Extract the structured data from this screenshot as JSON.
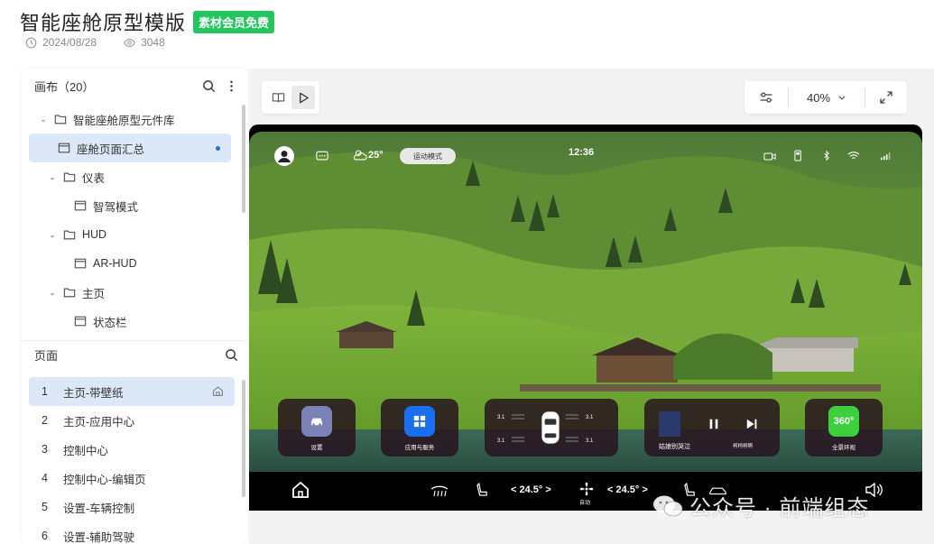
{
  "header": {
    "title": "智能座舱原型模版",
    "badge": "素材会员免费",
    "date": "2024/08/28",
    "views": "3048"
  },
  "canvas_panel": {
    "title": "画布（20）",
    "tree": [
      {
        "label": "智能座舱原型元件库",
        "type": "folder",
        "level": 1,
        "expanded": true
      },
      {
        "label": "座舱页面汇总",
        "type": "page",
        "level": 2,
        "selected": true
      },
      {
        "label": "仪表",
        "type": "folder",
        "level": 2,
        "expanded": true
      },
      {
        "label": "智驾模式",
        "type": "page",
        "level": 3
      },
      {
        "label": "HUD",
        "type": "folder",
        "level": 2,
        "expanded": true
      },
      {
        "label": "AR-HUD",
        "type": "page",
        "level": 3
      },
      {
        "label": "主页",
        "type": "folder",
        "level": 2,
        "expanded": true
      },
      {
        "label": "状态栏",
        "type": "page",
        "level": 3
      }
    ]
  },
  "pages_panel": {
    "title": "页面",
    "items": [
      {
        "num": "1",
        "label": "主页-带壁纸",
        "active": true
      },
      {
        "num": "2",
        "label": "主页-应用中心"
      },
      {
        "num": "3",
        "label": "控制中心"
      },
      {
        "num": "4",
        "label": "控制中心-编辑页"
      },
      {
        "num": "5",
        "label": "设置-车辆控制"
      },
      {
        "num": "6",
        "label": "设置-辅助驾驶"
      }
    ]
  },
  "toolbar": {
    "zoom": "40%"
  },
  "cockpit": {
    "weather_temp": "25°",
    "mode_pill": "运动模式",
    "clock": "12:36",
    "cards": {
      "settings": "设置",
      "apps": "应用与服务",
      "media_title": "姑娘别哭泣",
      "media_artist": "柯柯柯啊",
      "surround": "全景环视",
      "surround_icon": "360°"
    },
    "seat_values": [
      "3.1",
      "3.1",
      "3.1",
      "3.1"
    ],
    "climate_left": "< 24.5° >",
    "climate_right": "< 24.5° >",
    "fan_label": "自动"
  },
  "watermark": {
    "text": "公众号 · 前端组态"
  }
}
